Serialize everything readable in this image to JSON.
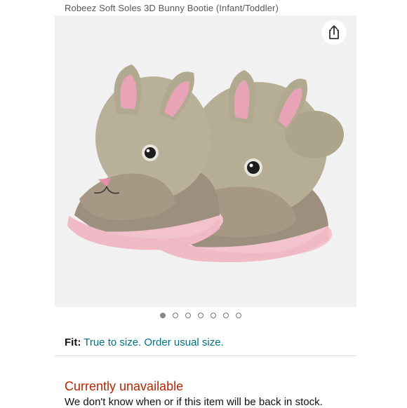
{
  "product": {
    "title": "Robeez Soft Soles 3D Bunny Bootie (Infant/Toddler)",
    "image_alt": "share-icon",
    "image_count": 7,
    "active_image_index": 0
  },
  "fit": {
    "label": "Fit:",
    "value": "True to size. Order usual size."
  },
  "availability": {
    "status": "Currently unavailable",
    "note": "We don't know when or if this item will be back in stock."
  },
  "colors": {
    "availability": "#b12704",
    "link": "#007185",
    "text": "#0f1111"
  }
}
